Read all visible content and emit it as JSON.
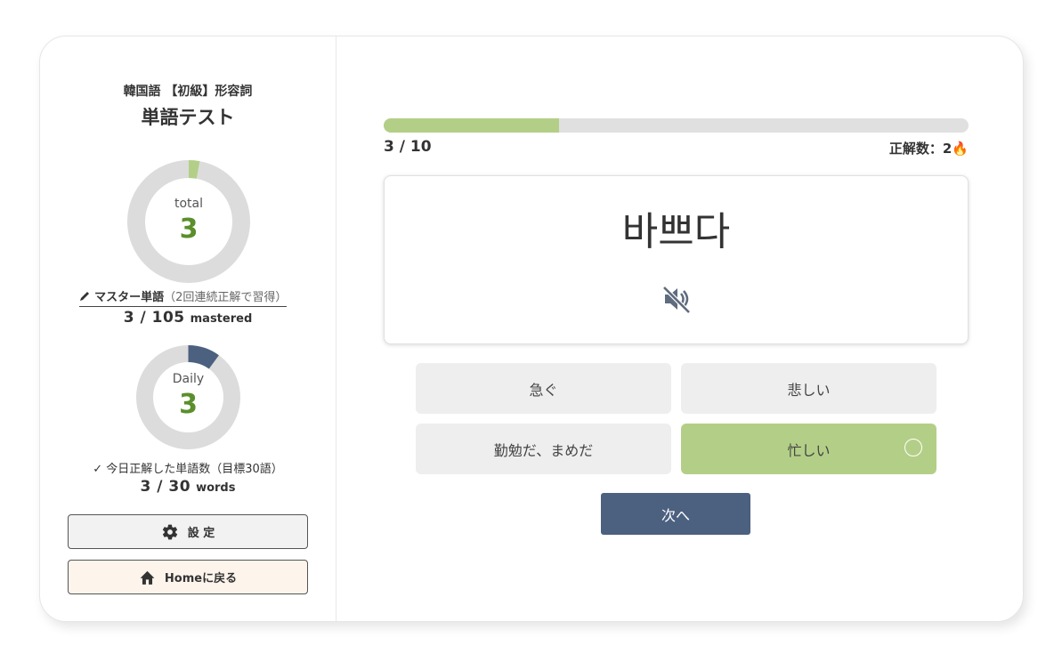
{
  "sidebar": {
    "title_small": "韓国語 【初級】形容詞",
    "title_big": "単語テスト",
    "total": {
      "label": "total",
      "value": "3",
      "fraction": 0.0286
    },
    "mastery": {
      "link_icon": "pencil-icon",
      "link_strong": "マスター単語",
      "link_sub": "（2回連続正解で習得）",
      "count": "3 / 105",
      "unit": "mastered"
    },
    "daily": {
      "label": "Daily",
      "value": "3",
      "fraction": 0.1,
      "caption": "✓ 今日正解した単語数（目標30語）",
      "count": "3 / 30",
      "unit": "words"
    },
    "settings_button": {
      "label": "設 定",
      "icon": "gear-icon"
    },
    "home_button": {
      "label": "Homeに戻る",
      "icon": "home-icon"
    }
  },
  "quiz": {
    "progress_text": "3 / 10",
    "progress_fraction": 0.3,
    "score_text": "正解数：2🔥",
    "word": "바쁘다",
    "audio_icon": "speaker-muted-icon",
    "options": [
      {
        "label": "急ぐ",
        "state": "default"
      },
      {
        "label": "悲しい",
        "state": "default"
      },
      {
        "label": "勤勉だ、まめだ",
        "state": "default"
      },
      {
        "label": "忙しい",
        "state": "correct"
      }
    ],
    "next_button": "次へ"
  },
  "colors": {
    "accent_green": "#b3cf87",
    "value_green": "#5a8f2b",
    "daily_navy": "#4c6080",
    "track_gray": "#dcdcdc"
  }
}
